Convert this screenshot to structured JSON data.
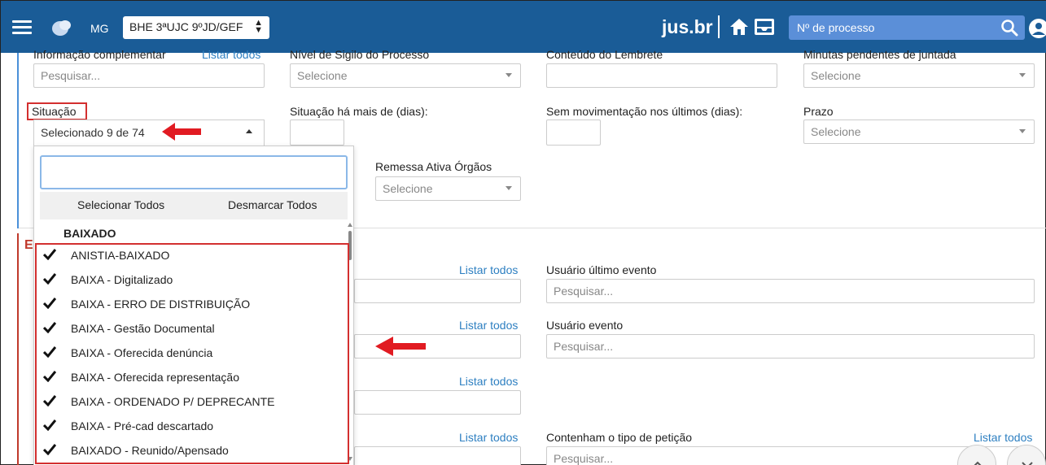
{
  "topbar": {
    "state": "MG",
    "unit_select": "BHE 3ªUJC 9ºJD/GEF",
    "brand": "jus.br",
    "process_search_placeholder": "Nº de processo"
  },
  "filters": {
    "info_complementar": {
      "label": "Informação complementar",
      "link": "Listar todos",
      "placeholder": "Pesquisar..."
    },
    "nivel_sigilo": {
      "label": "Nível de Sigilo do Processo",
      "value": "Selecione"
    },
    "conteudo_lembrete": {
      "label": "Conteúdo do Lembrete",
      "value": ""
    },
    "minutas": {
      "label": "Minutas pendentes de juntada",
      "value": "Selecione"
    },
    "situacao": {
      "label": "Situação",
      "value": "Selecionado 9 de 74"
    },
    "situacao_dias": {
      "label": "Situação há mais de (dias):",
      "value": ""
    },
    "sem_movimentacao": {
      "label": "Sem movimentação nos últimos (dias):",
      "value": ""
    },
    "prazo": {
      "label": "Prazo",
      "value": "Selecione"
    },
    "remessa": {
      "label": "Remessa Ativa Órgãos",
      "value": "Selecione"
    }
  },
  "section_e": {
    "label": "E",
    "listar_todos": "Listar todos",
    "usuario_ultimo_evento": {
      "label": "Usuário último evento",
      "placeholder": "Pesquisar..."
    },
    "usuario_evento": {
      "label": "Usuário evento",
      "placeholder": "Pesquisar..."
    },
    "tipo_peticao": {
      "label": "Contenham o tipo de petição",
      "link": "Listar todos",
      "placeholder": "Pesquisar..."
    }
  },
  "dropdown": {
    "search_value": "",
    "select_all": "Selecionar Todos",
    "deselect_all": "Desmarcar Todos",
    "group": "BAIXADO",
    "items": [
      {
        "label": "ANISTIA-BAIXADO",
        "checked": true
      },
      {
        "label": "BAIXA - Digitalizado",
        "checked": true
      },
      {
        "label": "BAIXA - ERRO DE DISTRIBUIÇÃO",
        "checked": true
      },
      {
        "label": "BAIXA - Gestão Documental",
        "checked": true
      },
      {
        "label": "BAIXA - Oferecida denúncia",
        "checked": true
      },
      {
        "label": "BAIXA - Oferecida representação",
        "checked": true
      },
      {
        "label": "BAIXA - ORDENADO P/ DEPRECANTE",
        "checked": true
      },
      {
        "label": "BAIXA - Pré-cad descartado",
        "checked": true
      },
      {
        "label": "BAIXADO - Reunido/Apensado",
        "checked": true
      }
    ]
  },
  "colors": {
    "topbar": "#1a5c97",
    "link": "#2d7fc1",
    "highlight": "#d32f2f"
  },
  "icons": [
    "menu-icon",
    "org-logo-icon",
    "home-icon",
    "inbox-icon",
    "search-icon",
    "user-icon",
    "check-icon",
    "arrow-left-icon",
    "chevron-up-icon",
    "chevron-down-icon"
  ]
}
